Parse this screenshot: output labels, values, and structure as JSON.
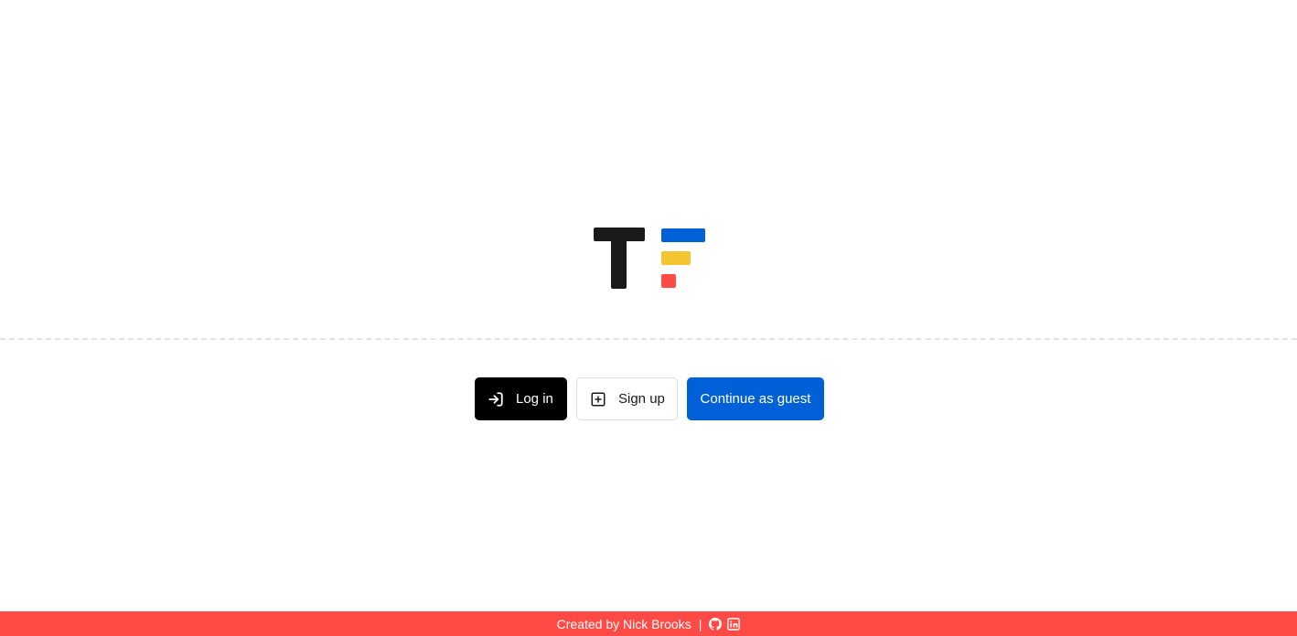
{
  "logo": {
    "letter_color": "#1a1a1a",
    "bars": [
      {
        "name": "blue",
        "color": "#0060d8"
      },
      {
        "name": "yellow",
        "color": "#f4c431"
      },
      {
        "name": "red",
        "color": "#ff4a45"
      }
    ]
  },
  "auth": {
    "login_label": "Log in",
    "login_icon": "login-arrow-icon",
    "signup_label": "Sign up",
    "signup_icon": "plus-square-icon",
    "guest_label": "Continue as guest"
  },
  "footer": {
    "credit_text": "Created by Nick Brooks",
    "separator": "|",
    "links": [
      {
        "icon": "github-icon"
      },
      {
        "icon": "linkedin-icon"
      }
    ],
    "background": "#ff4a45"
  }
}
